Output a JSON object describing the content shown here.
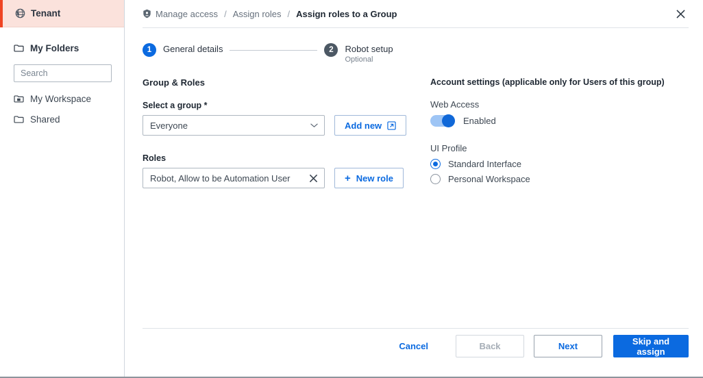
{
  "sidebar": {
    "tenant": {
      "label": "Tenant",
      "icon": "globe-icon",
      "accent_color": "#ef4423",
      "row_bg": "#fbe2dc"
    },
    "my_folders": {
      "label": "My Folders",
      "icon": "folder-icon"
    },
    "search": {
      "value": "",
      "placeholder": "Search",
      "icon": "search-icon"
    },
    "items": [
      {
        "label": "My Workspace",
        "icon": "workspace-folder-icon"
      },
      {
        "label": "Shared",
        "icon": "folder-icon"
      }
    ]
  },
  "header": {
    "breadcrumb": [
      {
        "label": "Manage access",
        "icon": "shield-icon",
        "current": false
      },
      {
        "label": "Assign roles",
        "current": false
      },
      {
        "label": "Assign roles to a Group",
        "current": true
      }
    ],
    "separator": "/",
    "close_icon": "close-icon"
  },
  "stepper": {
    "steps": [
      {
        "number": "1",
        "title": "General details",
        "subtitle": "",
        "state": "active"
      },
      {
        "number": "2",
        "title": "Robot setup",
        "subtitle": "Optional",
        "state": "inactive"
      }
    ],
    "active_color": "#0b6ae0",
    "inactive_color": "#4c5864"
  },
  "form": {
    "group_roles_title": "Group & Roles",
    "select_group": {
      "label": "Select a group *",
      "value": "Everyone",
      "chevron_icon": "chevron-down-icon",
      "add_new": {
        "label": "Add new",
        "icon": "external-link-icon"
      }
    },
    "roles": {
      "label": "Roles",
      "value": "Robot, Allow to be Automation User",
      "clear_icon": "close-icon",
      "new_role": {
        "label": "New role",
        "icon": "plus-icon",
        "plus": "+"
      }
    }
  },
  "account_settings": {
    "title": "Account settings (applicable only for Users of this group)",
    "web_access": {
      "label": "Web Access",
      "toggle_state": "Enabled",
      "toggle_on": true
    },
    "ui_profile": {
      "label": "UI Profile",
      "options": [
        {
          "label": "Standard Interface",
          "selected": true
        },
        {
          "label": "Personal Workspace",
          "selected": false
        }
      ]
    }
  },
  "footer": {
    "cancel": "Cancel",
    "back": "Back",
    "next": "Next",
    "skip_and_assign": "Skip and assign",
    "primary_color": "#0b6ae0"
  }
}
